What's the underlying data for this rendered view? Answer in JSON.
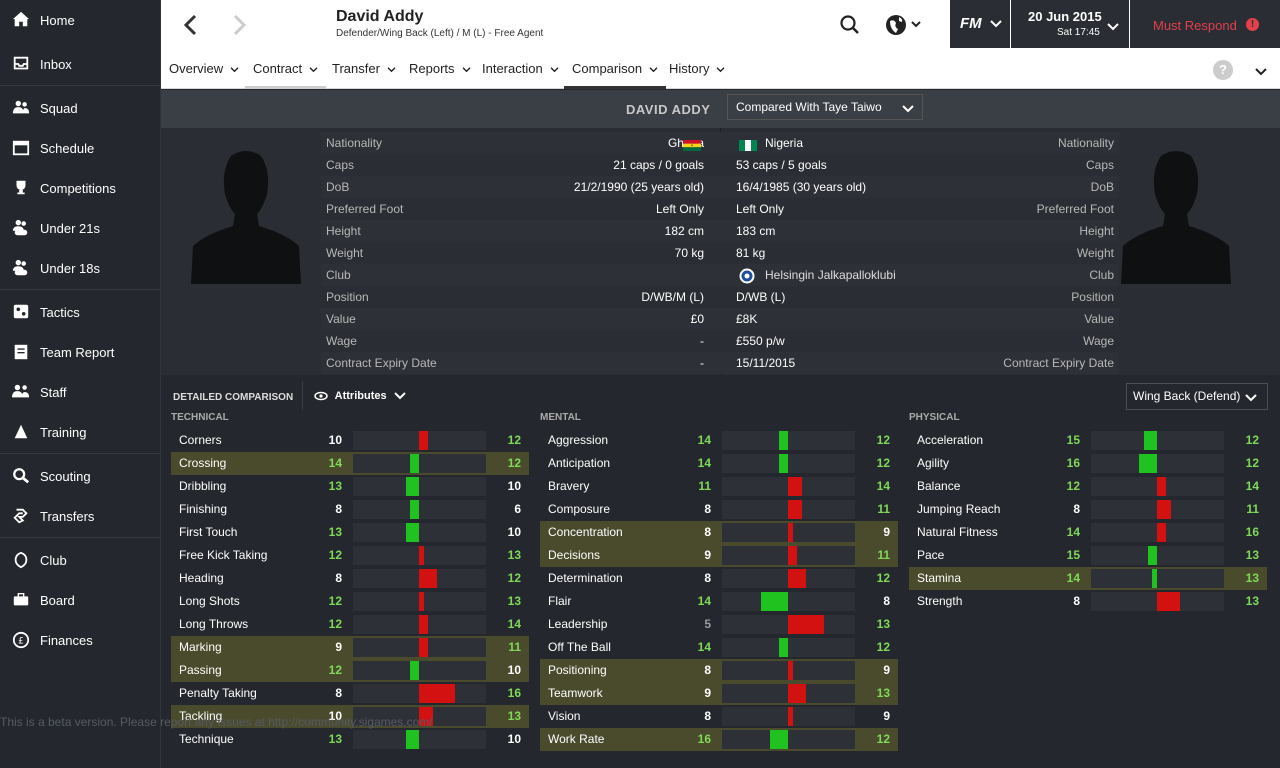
{
  "sidebar": {
    "items": [
      {
        "label": "Home",
        "icon": "home-icon"
      },
      {
        "label": "Inbox",
        "icon": "inbox-icon"
      },
      {
        "label": "Squad",
        "icon": "squad-icon"
      },
      {
        "label": "Schedule",
        "icon": "schedule-icon"
      },
      {
        "label": "Competitions",
        "icon": "trophy-icon"
      },
      {
        "label": "Under 21s",
        "icon": "under21-icon"
      },
      {
        "label": "Under 18s",
        "icon": "under18-icon"
      },
      {
        "label": "Tactics",
        "icon": "tactics-icon"
      },
      {
        "label": "Team Report",
        "icon": "team-report-icon"
      },
      {
        "label": "Staff",
        "icon": "staff-icon"
      },
      {
        "label": "Training",
        "icon": "training-icon"
      },
      {
        "label": "Scouting",
        "icon": "scouting-icon"
      },
      {
        "label": "Transfers",
        "icon": "transfers-icon"
      },
      {
        "label": "Club",
        "icon": "club-icon"
      },
      {
        "label": "Board",
        "icon": "board-icon"
      },
      {
        "label": "Finances",
        "icon": "finances-icon"
      }
    ]
  },
  "header": {
    "title": "David Addy",
    "subtitle": "Defender/Wing Back (Left) / M (L) - Free Agent",
    "date": "20 Jun 2015",
    "time": "Sat 17:45",
    "must_respond": "Must Respond",
    "fm_logo": "FM"
  },
  "tabs": [
    {
      "label": "Overview"
    },
    {
      "label": "Contract"
    },
    {
      "label": "Transfer"
    },
    {
      "label": "Reports"
    },
    {
      "label": "Interaction"
    },
    {
      "label": "Comparison"
    },
    {
      "label": "History"
    }
  ],
  "comparison": {
    "name": "DAVID ADDY",
    "select": "Compared With Taye Taiwo"
  },
  "info": {
    "labels": [
      "Nationality",
      "Caps",
      "DoB",
      "Preferred Foot",
      "Height",
      "Weight",
      "Club",
      "Position",
      "Value",
      "Wage",
      "Contract Expiry Date"
    ],
    "left": [
      "Ghana",
      "21 caps / 0 goals",
      "21/2/1990 (25 years old)",
      "Left Only",
      "182 cm",
      "70 kg",
      "",
      "D/WB/M (L)",
      "£0",
      "-",
      "-"
    ],
    "right": [
      "Nigeria",
      "53 caps / 5 goals",
      "16/4/1985 (30 years old)",
      "Left Only",
      "183 cm",
      "81 kg",
      "Helsingin Jalkapalloklubi",
      "D/WB (L)",
      "£8K",
      "£550 p/w",
      "15/11/2015"
    ]
  },
  "detail": {
    "heading": "DETAILED COMPARISON",
    "attributes_label": "Attributes",
    "role_select": "Wing Back (Defend)",
    "technical_label": "TECHNICAL",
    "mental_label": "MENTAL",
    "physical_label": "PHYSICAL",
    "technical": [
      {
        "name": "Corners",
        "a": 10,
        "b": 12,
        "hl": false
      },
      {
        "name": "Crossing",
        "a": 14,
        "b": 12,
        "hl": true
      },
      {
        "name": "Dribbling",
        "a": 13,
        "b": 10,
        "hl": false
      },
      {
        "name": "Finishing",
        "a": 8,
        "b": 6,
        "hl": false
      },
      {
        "name": "First Touch",
        "a": 13,
        "b": 10,
        "hl": false
      },
      {
        "name": "Free Kick Taking",
        "a": 12,
        "b": 13,
        "hl": false
      },
      {
        "name": "Heading",
        "a": 8,
        "b": 12,
        "hl": false
      },
      {
        "name": "Long Shots",
        "a": 12,
        "b": 13,
        "hl": false
      },
      {
        "name": "Long Throws",
        "a": 12,
        "b": 14,
        "hl": false
      },
      {
        "name": "Marking",
        "a": 9,
        "b": 11,
        "hl": true
      },
      {
        "name": "Passing",
        "a": 12,
        "b": 10,
        "hl": true
      },
      {
        "name": "Penalty Taking",
        "a": 8,
        "b": 16,
        "hl": false
      },
      {
        "name": "Tackling",
        "a": 10,
        "b": 13,
        "hl": true
      },
      {
        "name": "Technique",
        "a": 13,
        "b": 10,
        "hl": false
      }
    ],
    "mental": [
      {
        "name": "Aggression",
        "a": 14,
        "b": 12,
        "hl": false
      },
      {
        "name": "Anticipation",
        "a": 14,
        "b": 12,
        "hl": false
      },
      {
        "name": "Bravery",
        "a": 11,
        "b": 14,
        "hl": false
      },
      {
        "name": "Composure",
        "a": 8,
        "b": 11,
        "hl": false
      },
      {
        "name": "Concentration",
        "a": 8,
        "b": 9,
        "hl": true
      },
      {
        "name": "Decisions",
        "a": 9,
        "b": 11,
        "hl": true
      },
      {
        "name": "Determination",
        "a": 8,
        "b": 12,
        "hl": false
      },
      {
        "name": "Flair",
        "a": 14,
        "b": 8,
        "hl": false
      },
      {
        "name": "Leadership",
        "a": 5,
        "b": 13,
        "hl": false
      },
      {
        "name": "Off The Ball",
        "a": 14,
        "b": 12,
        "hl": false
      },
      {
        "name": "Positioning",
        "a": 8,
        "b": 9,
        "hl": true
      },
      {
        "name": "Teamwork",
        "a": 9,
        "b": 13,
        "hl": true
      },
      {
        "name": "Vision",
        "a": 8,
        "b": 9,
        "hl": false
      },
      {
        "name": "Work Rate",
        "a": 16,
        "b": 12,
        "hl": true
      }
    ],
    "physical": [
      {
        "name": "Acceleration",
        "a": 15,
        "b": 12,
        "hl": false
      },
      {
        "name": "Agility",
        "a": 16,
        "b": 12,
        "hl": false
      },
      {
        "name": "Balance",
        "a": 12,
        "b": 14,
        "hl": false
      },
      {
        "name": "Jumping Reach",
        "a": 8,
        "b": 11,
        "hl": false
      },
      {
        "name": "Natural Fitness",
        "a": 14,
        "b": 16,
        "hl": false
      },
      {
        "name": "Pace",
        "a": 15,
        "b": 13,
        "hl": false
      },
      {
        "name": "Stamina",
        "a": 14,
        "b": 13,
        "hl": true
      },
      {
        "name": "Strength",
        "a": 8,
        "b": 13,
        "hl": false
      }
    ]
  },
  "beta": "This is a beta version. Please report any issues at http://community.sigames.com/",
  "colors": {
    "green": "#1fc21f",
    "red": "#d41111",
    "highlight": "#4a4b2c",
    "good_value": "#7ed957",
    "neutral_value": "#ffffff",
    "poor_value": "#9a9a9a"
  }
}
